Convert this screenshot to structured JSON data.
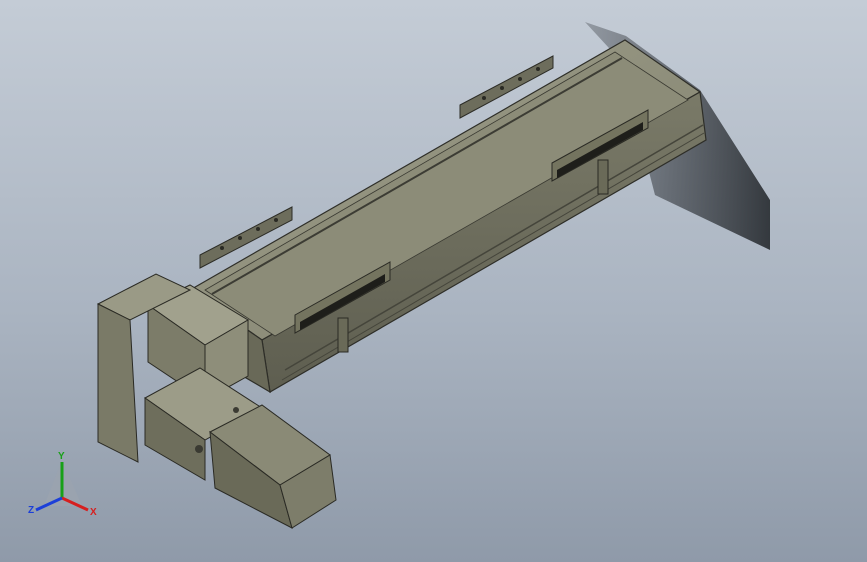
{
  "viewport": {
    "background_top": "#c4ccd6",
    "background_bottom": "#8f9aa9",
    "model": "linear-actuator-with-side-mounted-motor",
    "body_color": "#8f8f7a"
  },
  "triad": {
    "x_label": "X",
    "y_label": "Y",
    "z_label": "Z",
    "x_color": "#d61f1f",
    "y_color": "#18a018",
    "z_color": "#1c3fd8"
  }
}
